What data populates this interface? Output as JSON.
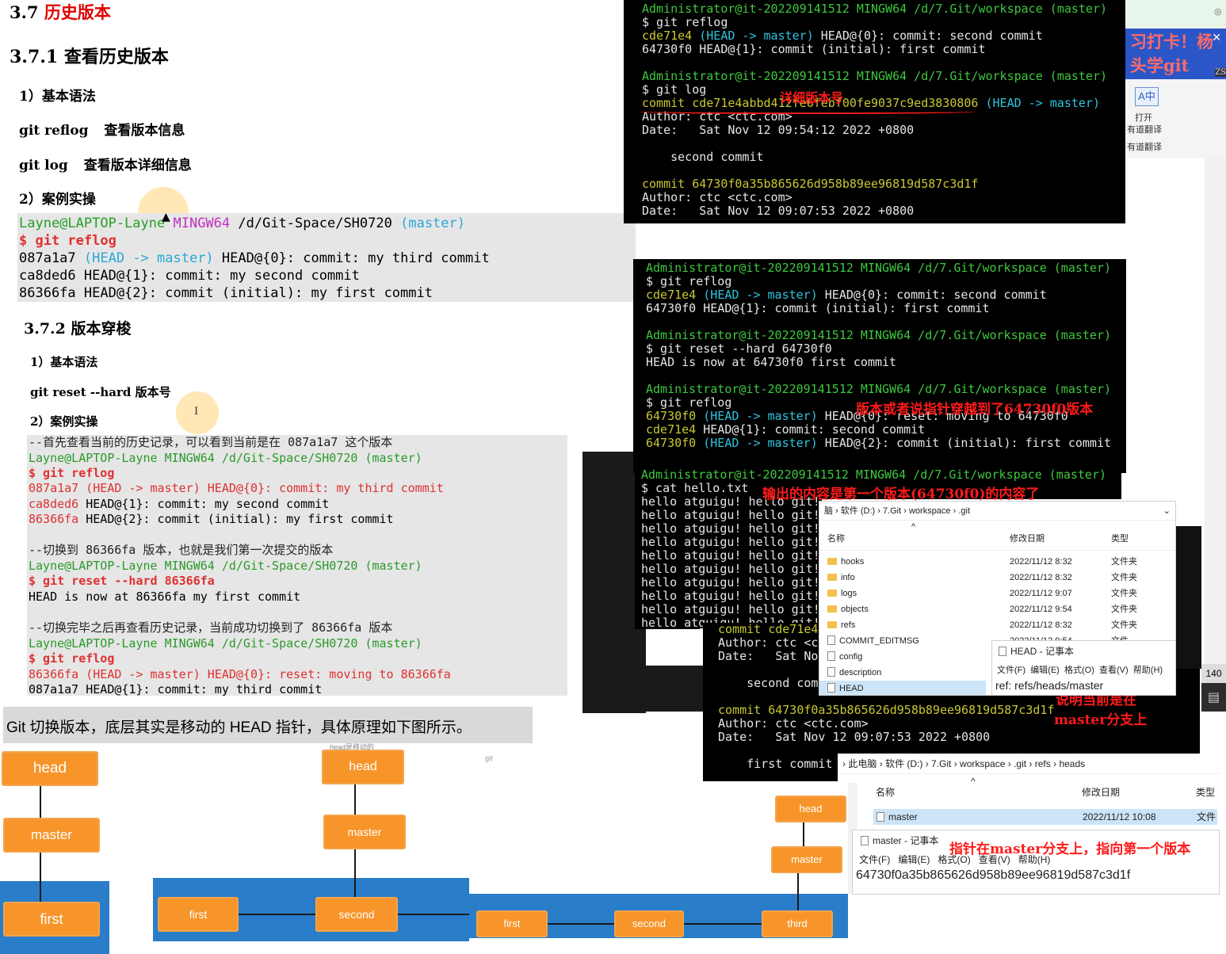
{
  "doc": {
    "sec37_num": "3.7",
    "sec37_title": "历史版本",
    "sec371": "3.7.1  查看历史版本",
    "syntax1": "1）基本语法",
    "reflog_cmd": "git reflog",
    "reflog_desc": "查看版本信息",
    "log_cmd": "git log",
    "log_desc": "查看版本详细信息",
    "case1": "2）案例实操",
    "sec372": "3.7.2  版本穿梭",
    "syntax2": "1）基本语法",
    "reset_cmd": "git reset --hard  版本号",
    "case2": "2）案例实操",
    "bottom_text": "Git 切换版本，底层其实是移动的 HEAD 指针，具体原理如下图所示。"
  },
  "code1": {
    "prompt_user": "Layne@LAPTOP-Layne",
    "prompt_env": "MINGW64",
    "prompt_path": "/d/Git-Space/SH0720",
    "prompt_branch": "(master)",
    "cmd": "$ git reflog",
    "line1_hash": "087a1a7",
    "line1_ref": "(HEAD -> master)",
    "line1_rest": "HEAD@{0}: commit: my third commit",
    "line2": "ca8ded6 HEAD@{1}: commit: my second commit",
    "line3": "86366fa HEAD@{2}: commit (initial): my first commit"
  },
  "code2": {
    "note1": "--首先查看当前的历史记录，可以看到当前是在 087a1a7 这个版本",
    "prompt": "Layne@LAPTOP-Layne MINGW64 /d/Git-Space/SH0720 (master)",
    "cmd_reflog": "$ git reflog",
    "r1": "087a1a7 (HEAD -> master) HEAD@{0}: commit: my third commit",
    "r2_hash": "ca8ded6",
    "r2_rest": " HEAD@{1}: commit: my second commit",
    "r3_hash": "86366fa",
    "r3_rest": " HEAD@{2}: commit (initial): my first commit",
    "note2": "--切换到 86366fa 版本，也就是我们第一次提交的版本",
    "cmd_reset": "$ git reset --hard 86366fa",
    "reset_out": "HEAD is now at 86366fa my first commit",
    "note3": "--切换完毕之后再查看历史记录，当前成功切换到了 86366fa 版本",
    "after1": "86366fa (HEAD -> master) HEAD@{0}: reset: moving to 86366fa",
    "after2": "087a1a7 HEAD@{1}: commit: my third commit"
  },
  "term1": {
    "prompt": "Administrator@it-202209141512 MINGW64 /d/7.Git/workspace (master)",
    "l_reflog": "$ git reflog",
    "ref1_hash": "cde71e4",
    "ref1_ref": "(HEAD -> master)",
    "ref1_rest": " HEAD@{0}: commit: second commit",
    "ref2": "64730f0 HEAD@{1}: commit (initial): first commit",
    "l_log": "$ git log",
    "commit1": "commit cde71e4abbd412fe6febf00fe9037c9ed3830806",
    "commit1_ref": " (HEAD -> master)",
    "author": "Author: ctc <ctc.com>",
    "date1": "Date:   Sat Nov 12 09:54:12 2022 +0800",
    "msg1": "    second commit",
    "commit2": "commit 64730f0a35b865626d958b89ee96819d587c3d1f",
    "date2": "Date:   Sat Nov 12 09:07:53 2022 +0800",
    "annotation": "详细版本号"
  },
  "term2": {
    "prompt": "Administrator@it-202209141512 MINGW64 /d/7.Git/workspace (master)",
    "l_reflog": "$ git reflog",
    "a1_hash": "cde71e4",
    "a1_ref": "(HEAD -> master)",
    "a1_rest": " HEAD@{0}: commit: second commit",
    "a2": "64730f0 HEAD@{1}: commit (initial): first commit",
    "l_reset": "$ git reset --hard 64730f0",
    "reset_out": "HEAD is now at 64730f0 first commit",
    "b1_hash": "64730f0",
    "b1_ref": "(HEAD -> master)",
    "b1_rest": " HEAD@{0}: reset: moving to 64730f0",
    "b2_hash": "cde71e4",
    "b2_rest": " HEAD@{1}: commit: second commit",
    "b3_hash": "64730f0",
    "b3_ref": "(HEAD -> master)",
    "b3_rest": " HEAD@{2}: commit (initial): first commit",
    "annotation": "版本或者说指针穿越到了64730f0版本"
  },
  "term3": {
    "prompt": "Administrator@it-202209141512 MINGW64 /d/7.Git/workspace (master)",
    "cmd": "$ cat hello.txt",
    "line": "hello atguigu! hello git!",
    "annotation": "输出的内容是第一个版本(64730f0)的内容了"
  },
  "term4": {
    "commit_partial": "commit cde71e4",
    "author": "Author: ctc <c",
    "date": "Date:   Sat No",
    "msg": "    second comm",
    "commit2": "commit 64730f0a35b865626d958b89ee96819d587c3d1f",
    "author2": "Author: ctc <ctc.com>",
    "date2": "Date:   Sat Nov 12 09:07:53 2022 +0800",
    "msg2": "    first commit",
    "annotation1": "说明当前是在",
    "annotation2": "master分支上"
  },
  "explorer1": {
    "crumbs": [
      "脑",
      "软件 (D:)",
      "7.Git",
      "workspace",
      ".git"
    ],
    "col_name": "名称",
    "col_date": "修改日期",
    "col_type": "类型",
    "rows": [
      {
        "name": "hooks",
        "date": "2022/11/12 8:32",
        "type": "文件夹",
        "folder": true
      },
      {
        "name": "info",
        "date": "2022/11/12 8:32",
        "type": "文件夹",
        "folder": true
      },
      {
        "name": "logs",
        "date": "2022/11/12 9:07",
        "type": "文件夹",
        "folder": true
      },
      {
        "name": "objects",
        "date": "2022/11/12 9:54",
        "type": "文件夹",
        "folder": true
      },
      {
        "name": "refs",
        "date": "2022/11/12 8:32",
        "type": "文件夹",
        "folder": true
      },
      {
        "name": "COMMIT_EDITMSG",
        "date": "2022/11/12 9:54",
        "type": "文件",
        "folder": false
      },
      {
        "name": "config",
        "date": "",
        "type": "",
        "folder": false
      },
      {
        "name": "description",
        "date": "",
        "type": "",
        "folder": false
      },
      {
        "name": "HEAD",
        "date": "",
        "type": "",
        "folder": false
      }
    ]
  },
  "notepad1": {
    "title": "HEAD - 记事本",
    "menu": [
      "文件(F)",
      "编辑(E)",
      "格式(O)",
      "查看(V)",
      "帮助(H)"
    ],
    "content": "ref: refs/heads/master"
  },
  "explorer2": {
    "crumbs": [
      "此电脑",
      "软件 (D:)",
      "7.Git",
      "workspace",
      ".git",
      "refs",
      "heads"
    ],
    "col_name": "名称",
    "col_date": "修改日期",
    "col_type": "类型",
    "row_name": "master",
    "row_date": "2022/11/12 10:08",
    "row_type": "文件"
  },
  "notepad2": {
    "title": "master - 记事本",
    "menu": [
      "文件(F)",
      "编辑(E)",
      "格式(O)",
      "查看(V)",
      "帮助(H)"
    ],
    "content": "64730f0a35b865626d958b89ee96819d587c3d1f",
    "annotation": "指针在master分支上，指向第一个版本"
  },
  "side_panel": {
    "banner": "习打卡！杨头学git",
    "zs": "ZS",
    "translate_label1": "打开",
    "translate_label2": "有道翻译",
    "translate_label3": "有道翻译",
    "zoom": "140"
  },
  "diagrams": {
    "d1": {
      "head": "head",
      "master": "master",
      "first": "first"
    },
    "d2": {
      "caption": "head是移动的",
      "head": "head",
      "master": "master",
      "first": "first",
      "second": "second"
    },
    "d3": {
      "caption": "git",
      "head": "head",
      "master": "master",
      "first": "first",
      "second": "second",
      "third": "third"
    }
  },
  "colors": {
    "node_orange": "#f7952a",
    "band_blue": "#2a7dc8",
    "annotation_red": "#ff1a1a"
  }
}
